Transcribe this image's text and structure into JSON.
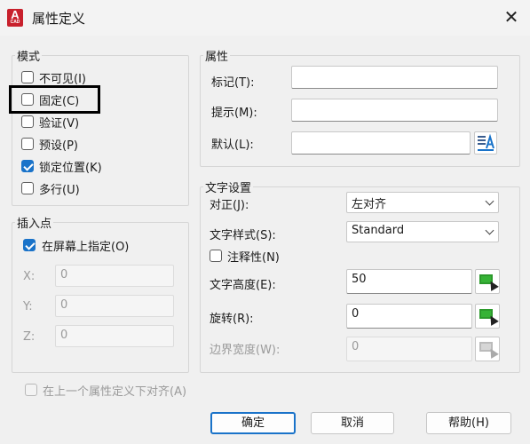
{
  "window": {
    "title": "属性定义",
    "app_badge": "A",
    "app_badge_sub": "CAD"
  },
  "mode": {
    "legend": "模式",
    "items": [
      {
        "label": "不可见(I)",
        "checked": false
      },
      {
        "label": "固定(C)",
        "checked": false
      },
      {
        "label": "验证(V)",
        "checked": false
      },
      {
        "label": "预设(P)",
        "checked": false
      },
      {
        "label": "锁定位置(K)",
        "checked": true
      },
      {
        "label": "多行(U)",
        "checked": false
      }
    ]
  },
  "attribute": {
    "legend": "属性",
    "tag_label": "标记(T):",
    "tag_value": "",
    "prompt_label": "提示(M):",
    "prompt_value": "",
    "default_label": "默认(L):",
    "default_value": ""
  },
  "insert_point": {
    "legend": "插入点",
    "specify_label": "在屏幕上指定(O)",
    "specify_checked": true,
    "x_label": "X:",
    "x_value": "0",
    "y_label": "Y:",
    "y_value": "0",
    "z_label": "Z:",
    "z_value": "0"
  },
  "text_settings": {
    "legend": "文字设置",
    "justify_label": "对正(J):",
    "justify_value": "左对齐",
    "style_label": "文字样式(S):",
    "style_value": "Standard",
    "annotative_label": "注释性(N)",
    "annotative_checked": false,
    "height_label": "文字高度(E):",
    "height_value": "50",
    "rotation_label": "旋转(R):",
    "rotation_value": "0",
    "boundary_label": "边界宽度(W):",
    "boundary_value": "0"
  },
  "align_below": {
    "label": "在上一个属性定义下对齐(A)",
    "checked": false
  },
  "buttons": {
    "ok": "确定",
    "cancel": "取消",
    "help": "帮助(H)"
  },
  "icons": {
    "close": "close-icon",
    "pick": "pick-point-icon",
    "field": "insert-field-icon"
  },
  "colors": {
    "accent": "#1a73c9",
    "highlight_border": "#000000",
    "app_icon": "#c8202c"
  }
}
